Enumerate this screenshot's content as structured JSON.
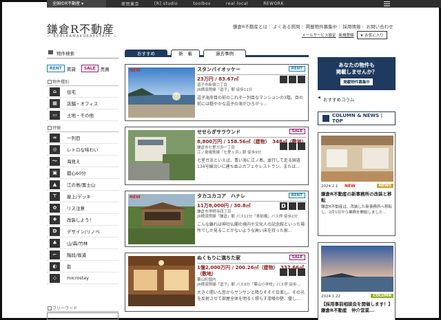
{
  "topbar": {
    "first": "全国のR不動産",
    "links": [
      "密買東京",
      "[R] studio",
      "toolbox",
      "real local",
      "REWORK"
    ]
  },
  "logo": {
    "main": "鎌倉R不動産",
    "sub": "— REALKAMAKURAESTATE —"
  },
  "header": {
    "links": [
      "鎌倉R不動産とは",
      "よくある質問",
      "掲載物件募集中",
      "採用情報",
      "お問い合わせ"
    ],
    "mail_service": "メールサービス設定",
    "register": "新規登録",
    "favorites": "★ お気に入り"
  },
  "sidebar": {
    "heading": "物件検索",
    "rent_tag": "RENT",
    "rent_label": "賃貸",
    "sale_tag": "SALE",
    "sale_label": "売買",
    "kind_heading": "物件種別",
    "kinds": [
      "住宅",
      "店舗・オフィス",
      "土地・その他"
    ],
    "feature_heading": "特徴",
    "features": [
      "一列目",
      "レトロな味わい",
      "海見え",
      "都心60分",
      "江の島/富士山",
      "屋上/デッキ",
      "リス注意",
      "改装しよう！",
      "デザイン/リノベ",
      "山/森/竹林",
      "階段/坂道",
      "影",
      "microstay"
    ],
    "freeword_heading": "フリーワード"
  },
  "tabs": [
    "おすすめ",
    "新　着",
    "過去事例"
  ],
  "listings": [
    {
      "is_new": true,
      "new_label": "NEW",
      "name": "スタンバイオッケー",
      "type": "RENT",
      "price": "23万円 / 83.67㎡",
      "address": [
        "逗子市新宿二丁目",
        "JR横須賀線「逗子」駅 徒歩11分"
      ],
      "desc": "逗子海岸目の前のこれぞ一列目なマンションの3階。目の前には穏やかな逗子の海がひろがっ..."
    },
    {
      "is_new": false,
      "new_label": "",
      "name": "せせらぎサラウンド",
      "type": "SALE",
      "price": "8,800万円 / 158.56㎡（建物）　348㎡（敷地）",
      "address": [
        "鎌倉市七里ガ浜一丁目",
        "江ノ島電鉄線「七里ヶ浜」駅 徒歩9分"
      ],
      "desc": "七里ガ浜といえば、青い海に江ノ島。並行して走る国道134号線沿いに建ち並ぶカフェやレストラン、または..."
    },
    {
      "is_new": true,
      "new_label": "NEW",
      "name": "タカユカコア　ハナレ",
      "type": "RENT",
      "price": "11万8,000円 / 30.8㎡",
      "address": [
        "鎌倉市浄明寺四丁目",
        "JR横須賀線「鎌倉」駅 バス12分「青砥橋」バス停 徒歩2分"
      ],
      "desc": "こんな離れは神社仏閣の境内や文化人の記念館といった場所でしか見ることがないような高い床を持った家..."
    },
    {
      "is_new": false,
      "new_label": "",
      "name": "ぬくもりに満ちた家",
      "type": "SALE",
      "price": "1億2,000万円 / 200.26㎡（建物）　337.66㎡（敷地）",
      "address": [
        "葉山町堀内",
        "JR横須賀線「逗子」駅 バス9分「葉山小学校」バス停 徒歩..."
      ],
      "desc": "大きく開いた窓からサンサンと降りそそぐ日差し、その光を反射させて部屋全体を明るく照らす漆喰の壁、優し..."
    }
  ],
  "promo": {
    "line1": "あなたの物件も",
    "line2": "掲載しませんか？",
    "button": "掲載物件募集中"
  },
  "column": {
    "heading": "おすすめコラム",
    "banner": "COLUMN & NEWS | TOP"
  },
  "news": [
    {
      "date": "2024.2.1",
      "new_label": "NEW",
      "category": "NEWS",
      "title": "鎌倉R不動産の新事務所の改装と移転",
      "excerpt": "鎌倉R不動産は、改装した新事務所へ移転し、2月1日から業務を開始しました..."
    },
    {
      "date": "2024.1.22",
      "new_label": "",
      "category": "COLUMN",
      "title": "【採用事前相談会を開催します！】鎌倉R不動産　仲介営業..."
    }
  ],
  "colors": {
    "navy": "#1f3a5f",
    "rent": "#1b7fb5",
    "sale": "#a0186e",
    "price": "#8a1d1d"
  }
}
